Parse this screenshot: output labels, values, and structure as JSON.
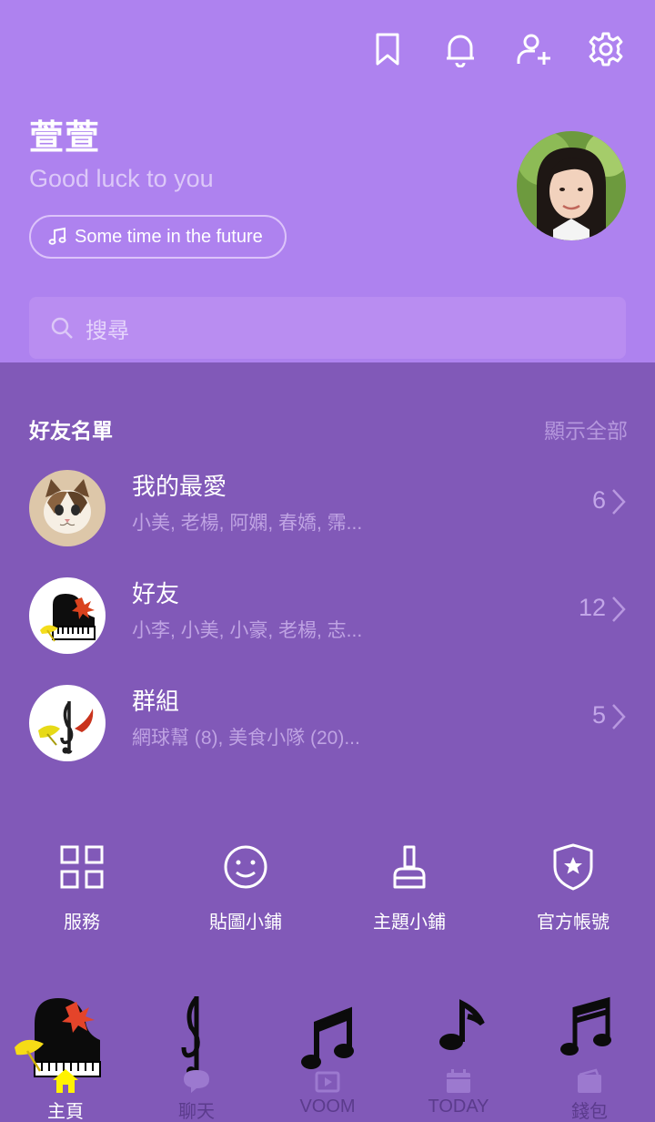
{
  "header": {
    "icons": [
      "bookmark-icon",
      "bell-icon",
      "add-friend-icon",
      "settings-icon"
    ],
    "bg_color": "#ae82ef"
  },
  "profile": {
    "name": "萱萱",
    "status": "Good luck to you",
    "music": "Some time in the future"
  },
  "search": {
    "placeholder": "搜尋"
  },
  "friends_section": {
    "title": "好友名單",
    "show_all": "顯示全部",
    "rows": [
      {
        "name": "我的最愛",
        "members": "小美, 老楊, 阿嫻, 春嬌, 霈...",
        "count": "6"
      },
      {
        "name": "好友",
        "members": "小李, 小美, 小豪, 老楊, 志...",
        "count": "12"
      },
      {
        "name": "群組",
        "members": "網球幫 (8), 美食小隊 (20)...",
        "count": "5"
      }
    ]
  },
  "services": [
    {
      "label": "服務",
      "icon": "grid-icon"
    },
    {
      "label": "貼圖小鋪",
      "icon": "smiley-icon"
    },
    {
      "label": "主題小鋪",
      "icon": "brush-icon"
    },
    {
      "label": "官方帳號",
      "icon": "shield-star-icon"
    }
  ],
  "bottom_nav": [
    {
      "label": "主頁",
      "icon": "home-icon",
      "active": true
    },
    {
      "label": "聊天",
      "icon": "chat-icon",
      "active": false
    },
    {
      "label": "VOOM",
      "icon": "voom-icon",
      "active": false
    },
    {
      "label": "TODAY",
      "icon": "today-icon",
      "active": false
    },
    {
      "label": "錢包",
      "icon": "wallet-icon",
      "active": false
    }
  ],
  "colors": {
    "header": "#ae82ef",
    "body": "#8159b8",
    "active_nav": "#fff200"
  }
}
